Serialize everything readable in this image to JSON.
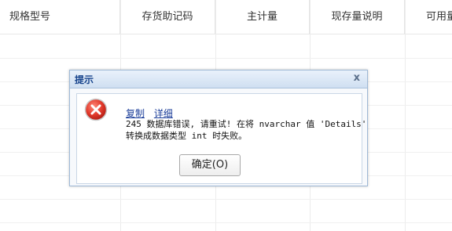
{
  "grid": {
    "columns": [
      "规格型号",
      "存货助记码",
      "主计量",
      "现存量说明",
      "可用量"
    ]
  },
  "dialog": {
    "title": "提示",
    "close_label": "x",
    "copy_link": "复制",
    "detail_link": "详细",
    "message_line1": "245 数据库错误, 请重试! 在将 nvarchar 值 'Details'",
    "message_line2": "转换成数据类型 int 时失败。",
    "ok_label": "确定(O)",
    "icon": "error-icon",
    "icon_color": "#d9342b"
  }
}
